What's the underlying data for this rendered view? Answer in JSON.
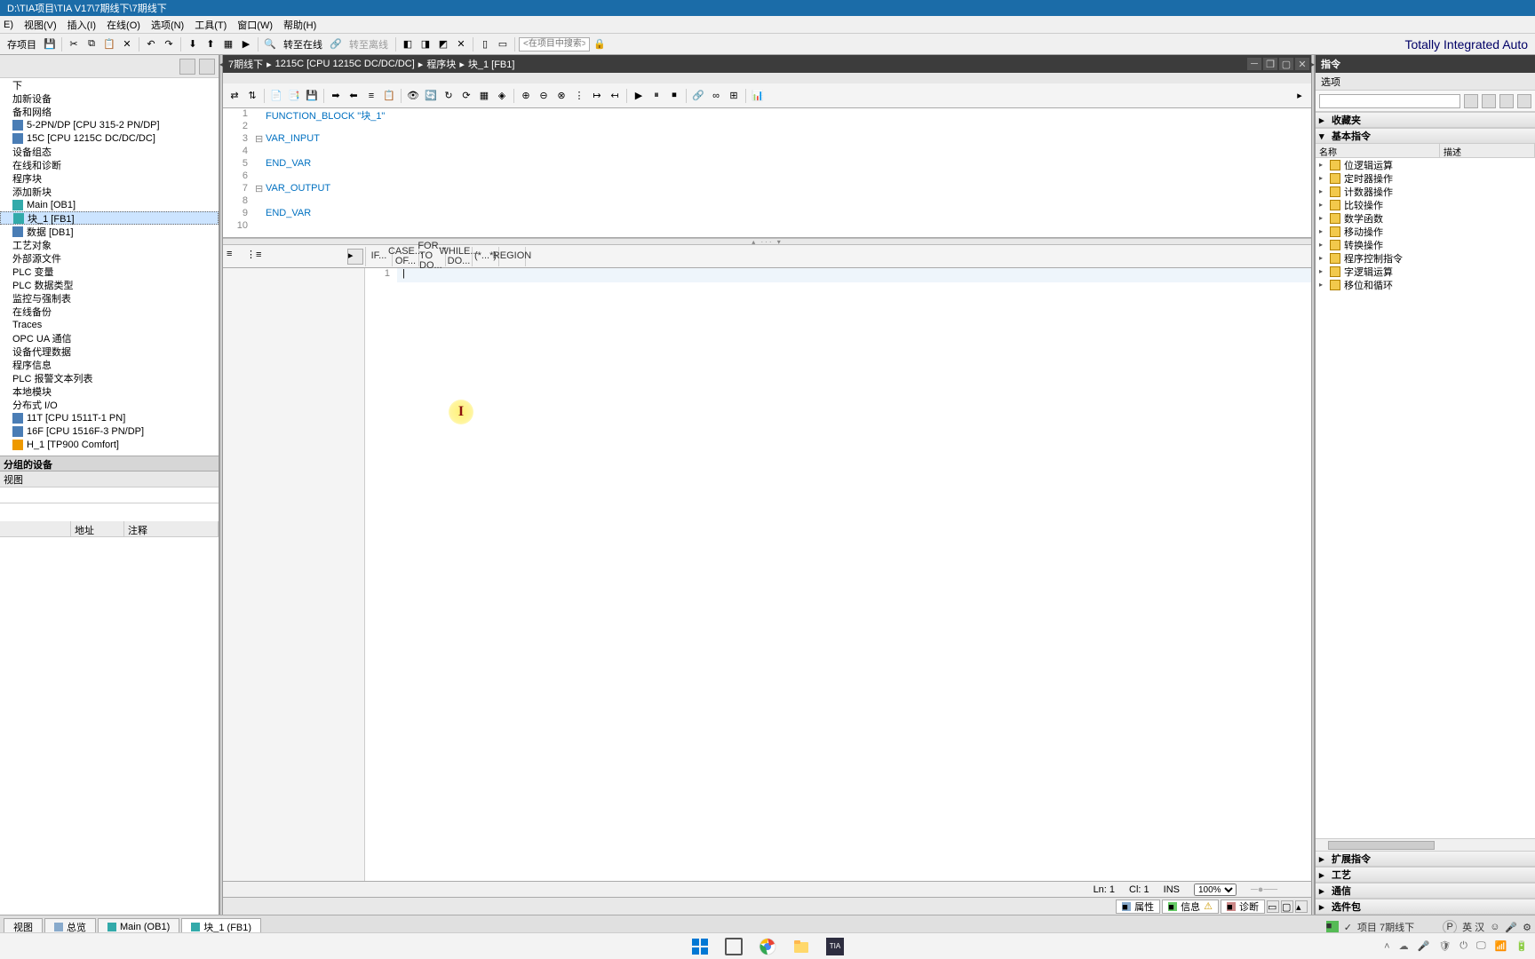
{
  "title": "D:\\TIA项目\\TIA V17\\7期线下\\7期线下",
  "menu": [
    "E)",
    "视图(V)",
    "插入(I)",
    "在线(O)",
    "选项(N)",
    "工具(T)",
    "窗口(W)",
    "帮助(H)"
  ],
  "toolbar": {
    "save": "存项目",
    "go_online": "转至在线",
    "go_offline": "转至离线",
    "search_placeholder": "<在项目中搜索>"
  },
  "brand": "Totally Integrated Auto",
  "left": {
    "tree": [
      {
        "label": "下",
        "icon": ""
      },
      {
        "label": "加新设备",
        "icon": ""
      },
      {
        "label": "备和网络",
        "icon": ""
      },
      {
        "label": "5-2PN/DP [CPU 315-2 PN/DP]",
        "icon": "blue"
      },
      {
        "label": "15C [CPU 1215C DC/DC/DC]",
        "icon": "blue"
      },
      {
        "label": "设备组态",
        "icon": ""
      },
      {
        "label": "在线和诊断",
        "icon": ""
      },
      {
        "label": "程序块",
        "icon": ""
      },
      {
        "label": "添加新块",
        "icon": ""
      },
      {
        "label": "Main [OB1]",
        "icon": "teal"
      },
      {
        "label": "块_1 [FB1]",
        "icon": "teal",
        "sel": true
      },
      {
        "label": "数据 [DB1]",
        "icon": "blue"
      },
      {
        "label": "工艺对象",
        "icon": ""
      },
      {
        "label": "外部源文件",
        "icon": ""
      },
      {
        "label": "PLC 变量",
        "icon": ""
      },
      {
        "label": "PLC 数据类型",
        "icon": ""
      },
      {
        "label": "监控与强制表",
        "icon": ""
      },
      {
        "label": "在线备份",
        "icon": ""
      },
      {
        "label": "Traces",
        "icon": ""
      },
      {
        "label": "OPC UA 通信",
        "icon": ""
      },
      {
        "label": "设备代理数据",
        "icon": ""
      },
      {
        "label": "程序信息",
        "icon": ""
      },
      {
        "label": "PLC 报警文本列表",
        "icon": ""
      },
      {
        "label": "本地模块",
        "icon": ""
      },
      {
        "label": "分布式 I/O",
        "icon": ""
      },
      {
        "label": "11T [CPU 1511T-1 PN]",
        "icon": "blue"
      },
      {
        "label": "16F [CPU 1516F-3 PN/DP]",
        "icon": "blue"
      },
      {
        "label": "H_1 [TP900 Comfort]",
        "icon": "orange"
      }
    ],
    "ungrouped": "分组的设备",
    "view": "视图",
    "col_addr": "地址",
    "col_comment": "注释"
  },
  "editor": {
    "breadcrumb": [
      "7期线下",
      "1215C [CPU 1215C DC/DC/DC]",
      "程序块",
      "块_1 [FB1]"
    ],
    "bc_sep": "▸",
    "code": [
      {
        "n": 1,
        "fold": "",
        "t": "FUNCTION_BLOCK \"块_1\""
      },
      {
        "n": 2,
        "fold": "",
        "t": ""
      },
      {
        "n": 3,
        "fold": "⊟",
        "t": "VAR_INPUT"
      },
      {
        "n": 4,
        "fold": "",
        "t": ""
      },
      {
        "n": 5,
        "fold": "",
        "t": "END_VAR"
      },
      {
        "n": 6,
        "fold": "",
        "t": ""
      },
      {
        "n": 7,
        "fold": "⊟",
        "t": "VAR_OUTPUT"
      },
      {
        "n": 8,
        "fold": "",
        "t": ""
      },
      {
        "n": 9,
        "fold": "",
        "t": "END_VAR"
      },
      {
        "n": 10,
        "fold": "",
        "t": ""
      }
    ],
    "snippets": [
      {
        "l1": "IF...",
        "l2": ""
      },
      {
        "l1": "CASE...",
        "l2": "OF..."
      },
      {
        "l1": "FOR...",
        "l2": "TO DO..."
      },
      {
        "l1": "WHILE...",
        "l2": "DO..."
      },
      {
        "l1": "(*...*)",
        "l2": ""
      },
      {
        "l1": "REGION",
        "l2": ""
      }
    ],
    "body_line": 1,
    "status": {
      "ln": "Ln: 1",
      "cl": "Cl: 1",
      "ins": "INS",
      "zoom": "100%"
    }
  },
  "prop_tabs": [
    "属性",
    "信息",
    "诊断"
  ],
  "right": {
    "title": "指令",
    "options": "选项",
    "favorites": "收藏夹",
    "basic": "基本指令",
    "col_name": "名称",
    "col_desc": "描述",
    "groups": [
      "位逻辑运算",
      "定时器操作",
      "计数器操作",
      "比较操作",
      "数学函数",
      "移动操作",
      "转换操作",
      "程序控制指令",
      "字逻辑运算",
      "移位和循环"
    ],
    "acc": [
      "扩展指令",
      "工艺",
      "通信",
      "选件包"
    ]
  },
  "doctabs": {
    "t1": "视图",
    "t2": "总览",
    "t3": "Main (OB1)",
    "t4": "块_1 (FB1)",
    "status": "项目 7期线下",
    "lang": "英   汉"
  }
}
